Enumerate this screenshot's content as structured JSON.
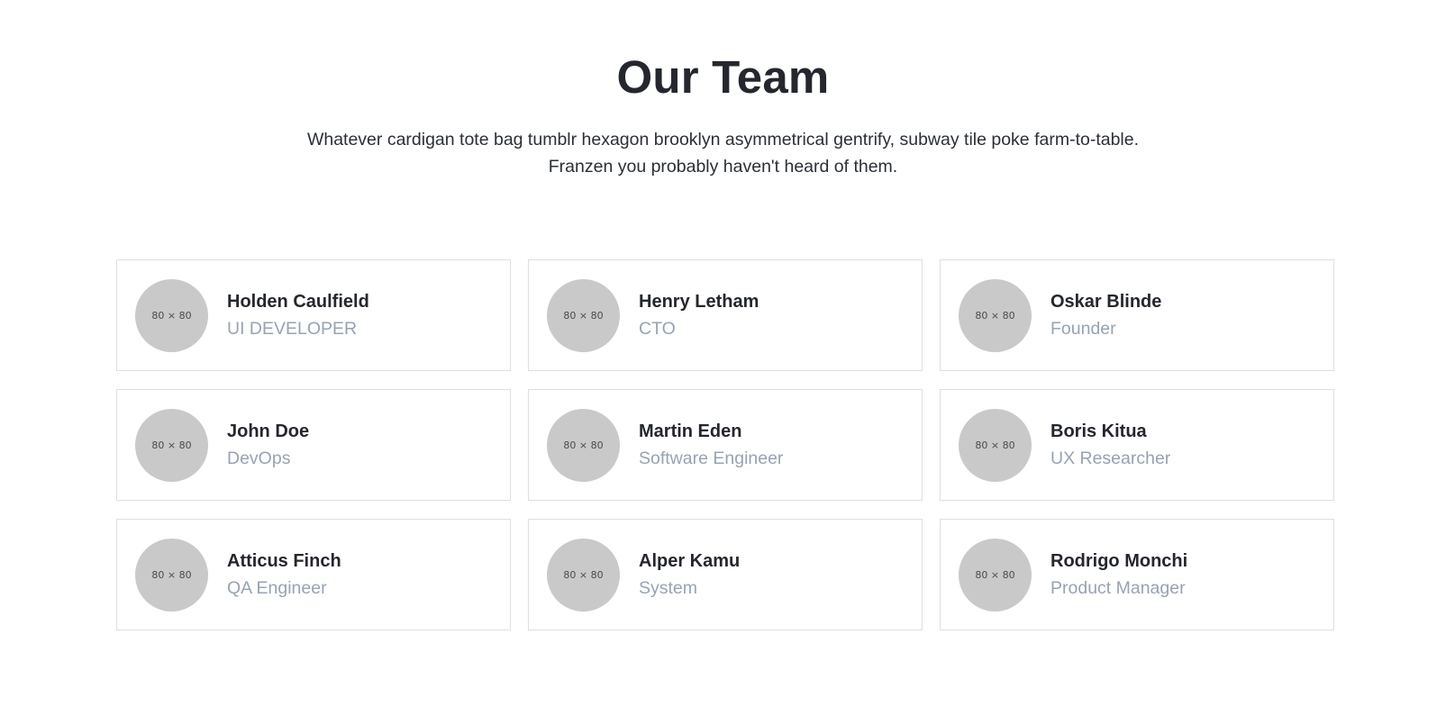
{
  "header": {
    "title": "Our Team",
    "description": "Whatever cardigan tote bag tumblr hexagon brooklyn asymmetrical gentrify, subway tile poke farm-to-table. Franzen you probably haven't heard of them."
  },
  "placeholder_label": "80 × 80",
  "team": [
    {
      "name": "Holden Caulfield",
      "role": "UI DEVELOPER"
    },
    {
      "name": "Henry Letham",
      "role": "CTO"
    },
    {
      "name": "Oskar Blinde",
      "role": "Founder"
    },
    {
      "name": "John Doe",
      "role": "DevOps"
    },
    {
      "name": "Martin Eden",
      "role": "Software Engineer"
    },
    {
      "name": "Boris Kitua",
      "role": "UX Researcher"
    },
    {
      "name": "Atticus Finch",
      "role": "QA Engineer"
    },
    {
      "name": "Alper Kamu",
      "role": "System"
    },
    {
      "name": "Rodrigo Monchi",
      "role": "Product Manager"
    }
  ],
  "colors": {
    "heading": "#24272d",
    "role_text": "#97a3b3",
    "avatar_bg": "#c9c9c9",
    "card_border": "#dcdfe4"
  }
}
